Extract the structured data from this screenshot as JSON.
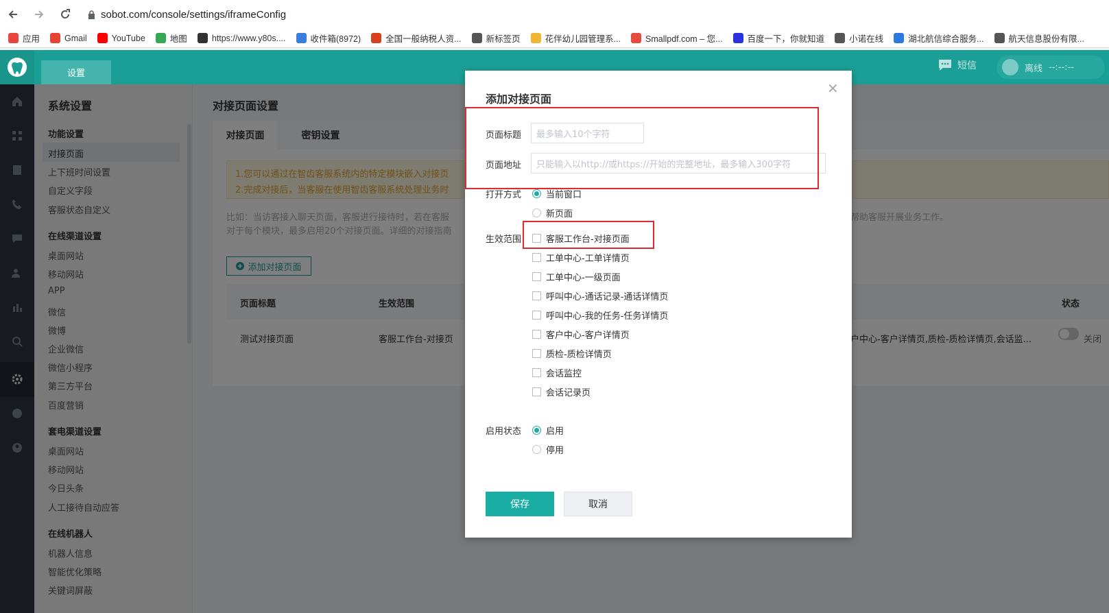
{
  "browser": {
    "url": "sobot.com/console/settings/iframeConfig",
    "bookmarks": [
      {
        "icon": "apps-grid-icon",
        "label": "应用",
        "color": "#e8453c"
      },
      {
        "icon": "gmail-icon",
        "label": "Gmail",
        "color": "#ea4335"
      },
      {
        "icon": "youtube-icon",
        "label": "YouTube",
        "color": "#ff0000"
      },
      {
        "icon": "maps-icon",
        "label": "地图",
        "color": "#34a853"
      },
      {
        "icon": "film-icon",
        "label": "https://www.y80s....",
        "color": "#333333"
      },
      {
        "icon": "mail-icon",
        "label": "收件箱(8972)",
        "color": "#3b7ddd"
      },
      {
        "icon": "tax-icon",
        "label": "全国一般纳税人资...",
        "color": "#d9401b"
      },
      {
        "icon": "globe-icon",
        "label": "新标签页",
        "color": "#555555"
      },
      {
        "icon": "flower-icon",
        "label": "花伴幼儿园管理系...",
        "color": "#f2b531"
      },
      {
        "icon": "smallpdf-icon",
        "label": "Smallpdf.com – 您...",
        "color": "#e64b3c"
      },
      {
        "icon": "baidu-icon",
        "label": "百度一下，你就知道",
        "color": "#2932e1"
      },
      {
        "icon": "globe-icon",
        "label": "小诺在线",
        "color": "#555555"
      },
      {
        "icon": "grid-icon",
        "label": "湖北航信综合服务...",
        "color": "#2a7ae2"
      },
      {
        "icon": "globe-icon",
        "label": "航天信息股份有限...",
        "color": "#555555"
      }
    ]
  },
  "header": {
    "tab_label": "设置",
    "sms_label": "短信",
    "status_label": "离线",
    "status_time": "--:--:--"
  },
  "nav": {
    "title": "系统设置",
    "sections": [
      {
        "title": "功能设置",
        "items": [
          "对接页面",
          "上下班时间设置",
          "自定义字段",
          "客服状态自定义"
        ]
      },
      {
        "title": "在线渠道设置",
        "items": [
          "桌面网站",
          "移动网站",
          "APP",
          "微信",
          "微博",
          "企业微信",
          "微信小程序",
          "第三方平台",
          "百度营销"
        ]
      },
      {
        "title": "套电渠道设置",
        "items": [
          "桌面网站",
          "移动网站",
          "今日头条",
          "人工接待自动应答"
        ]
      },
      {
        "title": "在线机器人",
        "items": [
          "机器人信息",
          "智能优化策略",
          "关键词屏蔽"
        ]
      }
    ]
  },
  "content": {
    "title": "对接页面设置",
    "tabs": [
      "对接页面",
      "密钥设置"
    ],
    "notice": [
      "1.您可以通过在智齿客服系统内的特定模块嵌入对接页",
      "2.完成对接后，当客服在使用智齿客服系统处理业务时"
    ],
    "description": [
      "比如：当访客接入聊天页面，客服进行接待时，若在客服",
      "对于每个模块，最多启用20个对接页面。详细的对接指南"
    ],
    "description_right": "帮助客服开展业务工作。",
    "add_button": "添加对接页面",
    "table": {
      "headers": [
        "页面标题",
        "生效范围",
        "状态"
      ],
      "row": {
        "title": "测试对接页面",
        "scope": "客服工作台-对接页",
        "scope_tail": "户中心-客户详情页,质检-质检详情页,会话监...",
        "status": "关闭"
      }
    }
  },
  "modal": {
    "title": "添加对接页面",
    "page_title_label": "页面标题",
    "page_title_placeholder": "最多输入10个字符",
    "page_url_label": "页面地址",
    "page_url_placeholder": "只能输入以http://或https://开始的完整地址，最多输入300字符",
    "open_mode_label": "打开方式",
    "open_mode_options": [
      {
        "label": "当前窗口",
        "selected": true
      },
      {
        "label": "新页面",
        "selected": false
      }
    ],
    "scope_label": "生效范围",
    "scope_options": [
      "客服工作台-对接页面",
      "工单中心-工单详情页",
      "工单中心-一级页面",
      "呼叫中心-通话记录-通话详情页",
      "呼叫中心-我的任务-任务详情页",
      "客户中心-客户详情页",
      "质检-质检详情页",
      "会话监控",
      "会话记录页"
    ],
    "enable_label": "启用状态",
    "enable_options": [
      {
        "label": "启用",
        "selected": true
      },
      {
        "label": "停用",
        "selected": false
      }
    ],
    "save_label": "保存",
    "cancel_label": "取消"
  },
  "colors": {
    "brand": "#1a9f96",
    "primary_button": "#1aada3",
    "highlight_box": "#e0292b",
    "notice_text": "#e0a32e"
  }
}
